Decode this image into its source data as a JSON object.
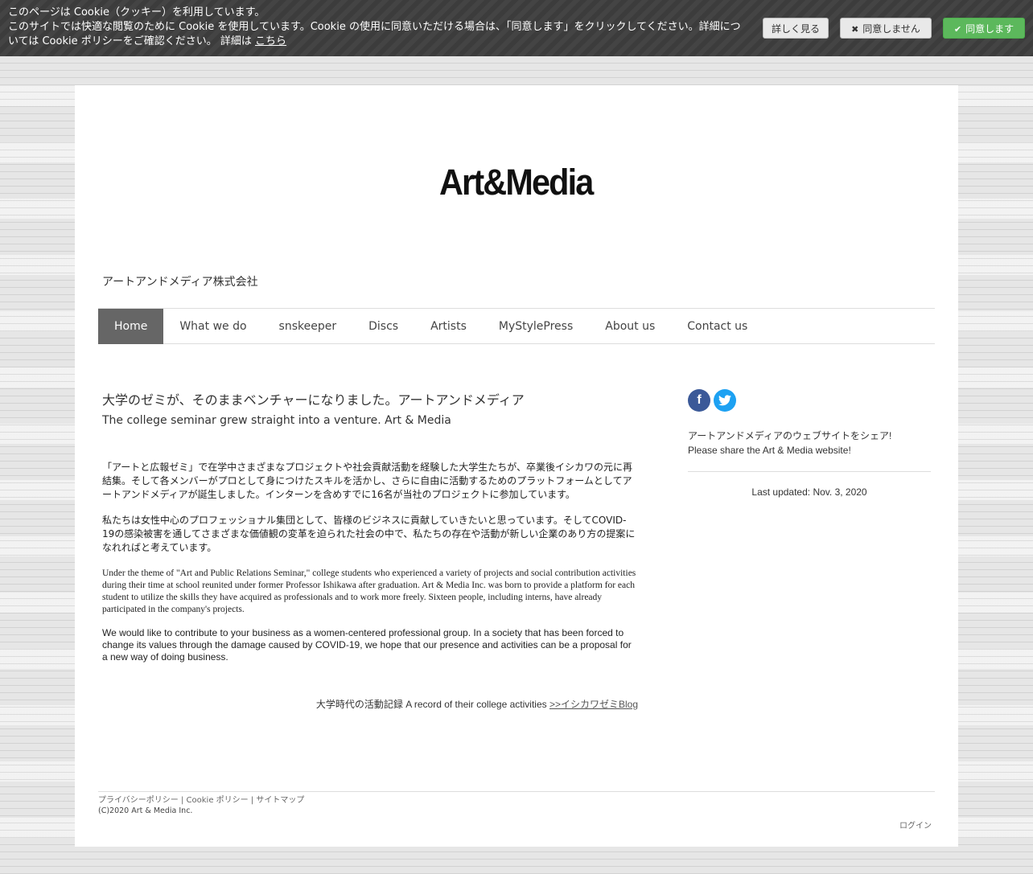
{
  "cookie": {
    "text_line1": "このページは Cookie（クッキー）を利用しています。",
    "text_line2": "このサイトでは快適な閲覧のために Cookie を使用しています。Cookie の使用に同意いただける場合は、「同意します」をクリックしてください。詳細については Cookie ポリシーをご確認ください。 詳細は",
    "link_label": "こちら",
    "detail_label": "詳しく見る",
    "decline_label": "同意しません",
    "accept_label": "同意します"
  },
  "site": {
    "logo_text": "Art&Media",
    "company_name": "アートアンドメディア株式会社"
  },
  "nav": {
    "items": [
      {
        "label": "Home"
      },
      {
        "label": "What we do"
      },
      {
        "label": "snskeeper"
      },
      {
        "label": "Discs"
      },
      {
        "label": "Artists"
      },
      {
        "label": "MyStylePress"
      },
      {
        "label": "About us"
      },
      {
        "label": "Contact us"
      }
    ]
  },
  "main": {
    "heading_jp": "大学のゼミが、そのままベンチャーになりました。アートアンドメディア",
    "heading_en": "The college seminar grew straight into a venture. Art & Media",
    "para_jp1": "「アートと広報ゼミ」で在学中さまざまなプロジェクトや社会貢献活動を経験した大学生たちが、卒業後イシカワの元に再結集。そして各メンバーがプロとして身につけたスキルを活かし、さらに自由に活動するためのプラットフォームとしてアートアンドメディアが誕生しました。インターンを含めすでに16名が当社のプロジェクトに参加しています。",
    "para_jp2": "私たちは女性中心のプロフェッショナル集団として、皆様のビジネスに貢献していきたいと思っています。そしてCOVID-19の感染被害を通してさまざまな価値観の変革を迫られた社会の中で、私たちの存在や活動が新しい企業のあり方の提案になれればと考えています。",
    "para_en1": "Under the theme of \"Art and Public Relations Seminar,\" college students who experienced a variety of projects and social contribution activities during their time at school reunited under former Professor Ishikawa after graduation. Art & Media Inc. was born to provide a platform for each student to utilize the skills they have acquired as professionals and to work more freely. Sixteen people, including interns, have already participated in the company's projects.",
    "para_en2": "We would like to contribute to your business as a women-centered professional group. In a society that has been forced to change its values through the damage caused by COVID-19, we hope that our presence and activities can be a proposal for a new way of doing business.",
    "record_text": "大学時代の活動記録  A record of their college activities  ",
    "record_link": ">>イシカワゼミBlog"
  },
  "sidebar": {
    "facebook_glyph": "f",
    "twitter_glyph": "t",
    "share_jp": "アートアンドメディアのウェブサイトをシェア!",
    "share_en": "Please share the Art & Media website!",
    "last_updated": "Last updated: Nov. 3, 2020"
  },
  "footer": {
    "privacy": "プライバシーポリシー",
    "cookie_policy": "Cookie ポリシー",
    "sitemap": "サイトマップ",
    "separator": " | ",
    "copyright": "(C)2020 Art & Media Inc.",
    "login": "ログイン"
  }
}
